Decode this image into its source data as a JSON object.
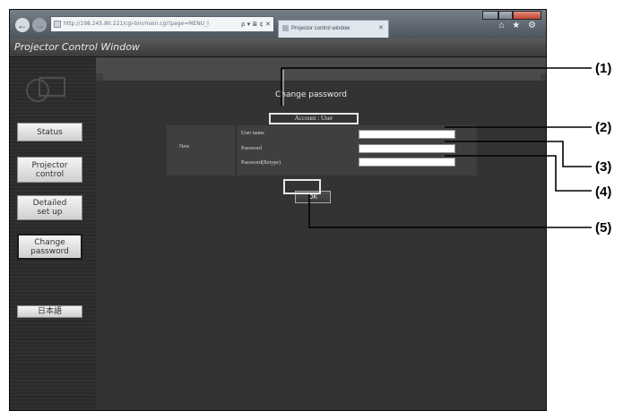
{
  "browser": {
    "address_url": "http://198.245.80.221/cgi-bin/main.cgi?page=MENU_I",
    "address_controls": "ρ ▾ ≣ ¢ ✕",
    "tab_title": "Projector control window",
    "tab_close": "✕",
    "toolbar_icons": "⌂ ★ ⚙"
  },
  "app": {
    "title": "Projector Control Window"
  },
  "sidebar": {
    "items": [
      {
        "label": "Status"
      },
      {
        "label": "Projector\ncontrol"
      },
      {
        "label": "Detailed\nset up"
      },
      {
        "label": "Change\npassword"
      },
      {
        "label": "日本語"
      }
    ]
  },
  "page": {
    "heading": "Change password",
    "account_label": "Account : User",
    "section_label": "New",
    "fields": [
      {
        "label": "User name",
        "value": ""
      },
      {
        "label": "Password",
        "value": ""
      },
      {
        "label": "Password(Retype)",
        "value": ""
      }
    ],
    "ok_label": "OK"
  },
  "callouts": [
    "(1)",
    "(2)",
    "(3)",
    "(4)",
    "(5)"
  ]
}
